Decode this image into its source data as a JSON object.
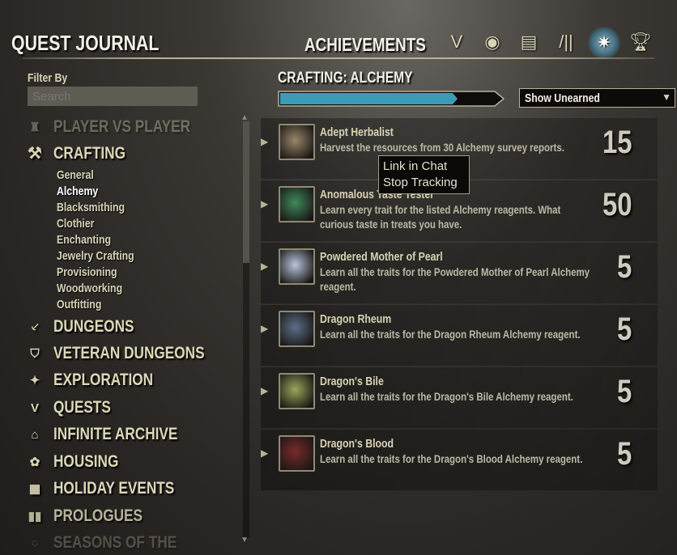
{
  "header": {
    "title": "QUEST JOURNAL",
    "section": "ACHIEVEMENTS",
    "tabs": [
      {
        "icon": "alliance-banner-icon",
        "active": false
      },
      {
        "icon": "group-eye-icon",
        "active": false
      },
      {
        "icon": "scroll-icon",
        "active": false
      },
      {
        "icon": "books-icon",
        "active": false
      },
      {
        "icon": "compass-star-icon",
        "active": true
      },
      {
        "icon": "trophy-icon",
        "active": false
      }
    ]
  },
  "sidebar": {
    "filter_label": "Filter By",
    "search_placeholder": "Search",
    "categories": [
      {
        "label": "PLAYER VS PLAYER",
        "icon": "tower-icon"
      },
      {
        "label": "CRAFTING",
        "icon": "hammer-icon"
      },
      {
        "label": "DUNGEONS",
        "icon": "dungeon-icon"
      },
      {
        "label": "VETERAN DUNGEONS",
        "icon": "shield-icon"
      },
      {
        "label": "EXPLORATION",
        "icon": "compass-icon"
      },
      {
        "label": "QUESTS",
        "icon": "quest-icon"
      },
      {
        "label": "INFINITE ARCHIVE",
        "icon": "archive-icon"
      },
      {
        "label": "HOUSING",
        "icon": "house-icon"
      },
      {
        "label": "HOLIDAY EVENTS",
        "icon": "calendar-icon"
      },
      {
        "label": "PROLOGUES",
        "icon": "book-icon"
      },
      {
        "label": "SEASONS OF THE",
        "icon": "seasons-icon"
      }
    ],
    "subcategories": [
      "General",
      "Alchemy",
      "Blacksmithing",
      "Clothier",
      "Enchanting",
      "Jewelry Crafting",
      "Provisioning",
      "Woodworking",
      "Outfitting"
    ],
    "selected_subcategory": "Alchemy"
  },
  "main": {
    "title": "CRAFTING: ALCHEMY",
    "progress": 0.83,
    "progress_color": "#3f9bb5",
    "filter_dropdown": "Show Unearned",
    "achievements": [
      {
        "title": "Adept Herbalist",
        "desc": "Harvest the resources from 30 Alchemy survey reports.",
        "points": "15",
        "icon": "survey-map-icon",
        "color": "#9a8668"
      },
      {
        "title": "Anomalous Taste Tester",
        "desc": "Learn every trait for the listed Alchemy reagents. What curious taste in treats you have.",
        "points": "50",
        "icon": "green-potion-icon",
        "color": "#3f8a5a"
      },
      {
        "title": "Powdered Mother of Pearl",
        "desc": "Learn all the traits for the Powdered Mother of Pearl Alchemy reagent.",
        "points": "5",
        "icon": "pearl-powder-icon",
        "color": "#b8c6dc"
      },
      {
        "title": "Dragon Rheum",
        "desc": "Learn all the traits for the Dragon Rheum Alchemy reagent.",
        "points": "5",
        "icon": "rheum-vial-icon",
        "color": "#5c6f88"
      },
      {
        "title": "Dragon's Bile",
        "desc": "Learn all the traits for the Dragon's Bile Alchemy reagent.",
        "points": "5",
        "icon": "bile-flask-icon",
        "color": "#9ea55a"
      },
      {
        "title": "Dragon's Blood",
        "desc": "Learn all the traits for the Dragon's Blood Alchemy reagent.",
        "points": "5",
        "icon": "blood-jar-icon",
        "color": "#7a2a2a"
      }
    ]
  },
  "context_menu": [
    "Link in Chat",
    "Stop Tracking"
  ]
}
